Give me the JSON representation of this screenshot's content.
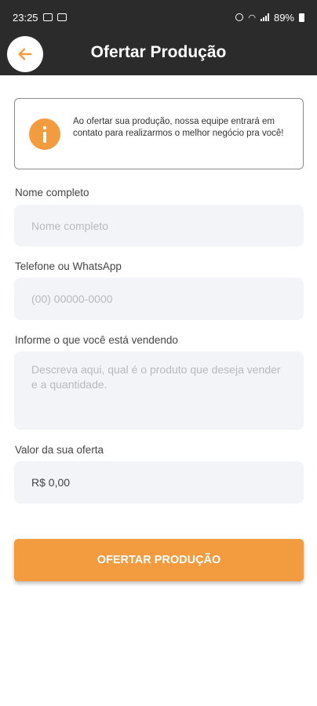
{
  "status_bar": {
    "time": "23:25",
    "battery": "89%"
  },
  "header": {
    "title": "Ofertar Produção",
    "back_icon": "arrow-left-icon"
  },
  "info_card": {
    "icon": "info-icon",
    "text": "Ao ofertar sua produção, nossa equipe entrará em contato para realizarmos o melhor negócio pra você!"
  },
  "form": {
    "name": {
      "label": "Nome completo",
      "placeholder": "Nome completo"
    },
    "phone": {
      "label": "Telefone ou WhatsApp",
      "placeholder": "(00) 00000-0000"
    },
    "description": {
      "label": "Informe o que você está vendendo",
      "placeholder": "Descreva aqui, qual é o produto que deseja vender e a quantidade."
    },
    "offer": {
      "label": "Valor da sua oferta",
      "value": "R$ 0,00"
    }
  },
  "submit_label": "OFERTAR PRODUÇÃO",
  "colors": {
    "accent": "#f29b3f",
    "header_bg": "#2b2b2b",
    "field_bg": "#f2f4f8"
  }
}
